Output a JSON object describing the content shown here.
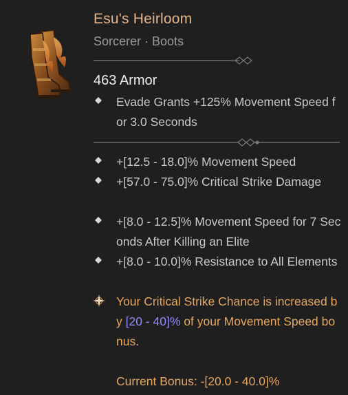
{
  "item": {
    "name": "Esu's Heirloom",
    "class_type": "Sorcerer · Boots",
    "armor": "463 Armor",
    "image_icon": "boots-icon"
  },
  "implicit": {
    "text": "Evade Grants +125% Movement Speed for 3.0 Seconds"
  },
  "affixes": [
    "+[12.5 - 18.0]% Movement Speed",
    "+[57.0 - 75.0]% Critical Strike Damage",
    "+[8.0 - 12.5]% Movement Speed for 7 Seconds After Killing an Elite",
    "+[8.0 - 10.0]% Resistance to All Elements"
  ],
  "unique_power": {
    "text_before": "Your Critical Strike Chance is increased by ",
    "range": "[20 - 40]%",
    "text_after": " of your Movement Speed bonus.",
    "current_bonus_label": "Current Bonus: ",
    "current_bonus_value": "-[20.0 - 40.0]%"
  },
  "colors": {
    "title": "#e3b48a",
    "unique": "#e6a760",
    "range": "#8f8cff",
    "background": "#1f1f1f"
  }
}
